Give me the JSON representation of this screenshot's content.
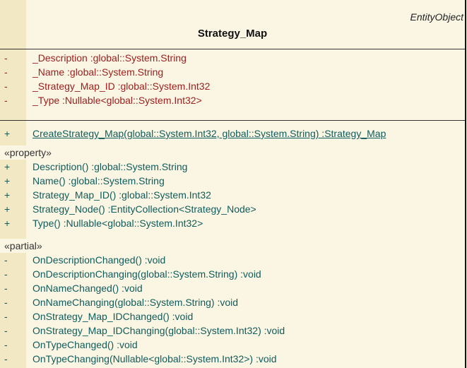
{
  "class": {
    "stereotype": "EntityObject",
    "name": "Strategy_Map"
  },
  "attributes": [
    {
      "visibility": "-",
      "text": "_Description  :global::System.String"
    },
    {
      "visibility": "-",
      "text": "_Name  :global::System.String"
    },
    {
      "visibility": "-",
      "text": "_Strategy_Map_ID  :global::System.Int32"
    },
    {
      "visibility": "-",
      "text": "_Type  :Nullable<global::System.Int32>"
    }
  ],
  "static_operations": [
    {
      "visibility": "+",
      "text": "CreateStrategy_Map(global::System.Int32, global::System.String)  :Strategy_Map"
    }
  ],
  "property_group": {
    "label": "«property»",
    "items": [
      {
        "visibility": "+",
        "text": "Description()  :global::System.String"
      },
      {
        "visibility": "+",
        "text": "Name()  :global::System.String"
      },
      {
        "visibility": "+",
        "text": "Strategy_Map_ID()  :global::System.Int32"
      },
      {
        "visibility": "+",
        "text": "Strategy_Node()  :EntityCollection<Strategy_Node>"
      },
      {
        "visibility": "+",
        "text": "Type()  :Nullable<global::System.Int32>"
      }
    ]
  },
  "partial_group": {
    "label": "«partial»",
    "items": [
      {
        "visibility": "-",
        "text": "OnDescriptionChanged()  :void"
      },
      {
        "visibility": "-",
        "text": "OnDescriptionChanging(global::System.String)  :void"
      },
      {
        "visibility": "-",
        "text": "OnNameChanged()  :void"
      },
      {
        "visibility": "-",
        "text": "OnNameChanging(global::System.String)  :void"
      },
      {
        "visibility": "-",
        "text": "OnStrategy_Map_IDChanged()  :void"
      },
      {
        "visibility": "-",
        "text": "OnStrategy_Map_IDChanging(global::System.Int32)  :void"
      },
      {
        "visibility": "-",
        "text": "OnTypeChanged()  :void"
      },
      {
        "visibility": "-",
        "text": "OnTypeChanging(Nullable<global::System.Int32>)  :void"
      }
    ]
  },
  "colors": {
    "attribute_text": "#9b1c1c",
    "operation_text": "#0e5c5c",
    "box_background": "#fbf6e3",
    "gutter_background": "#f3e8c4"
  }
}
